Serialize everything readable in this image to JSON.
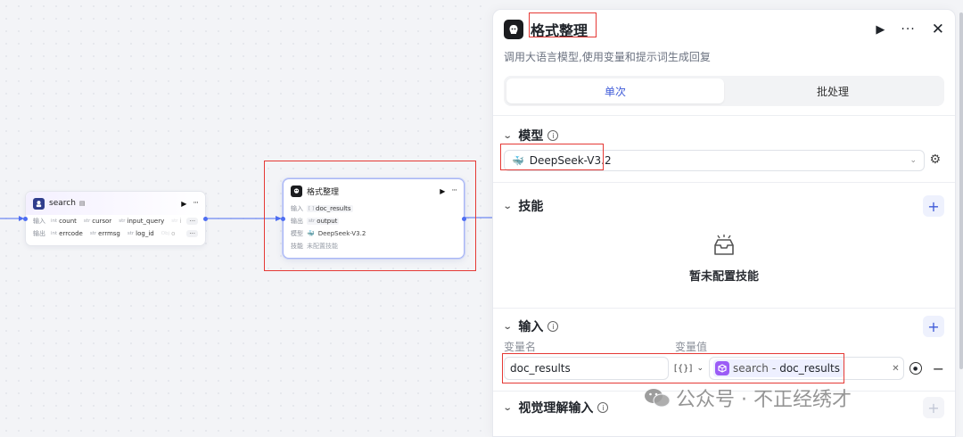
{
  "canvas": {
    "search_node": {
      "title": "search",
      "input_label": "输入",
      "output_label": "输出",
      "inputs": [
        {
          "type": "int",
          "name": "count"
        },
        {
          "type": "str",
          "name": "cursor"
        },
        {
          "type": "str",
          "name": "input_query"
        },
        {
          "type": "str",
          "name": "i"
        }
      ],
      "outputs": [
        {
          "type": "int",
          "name": "errcode"
        },
        {
          "type": "str",
          "name": "errmsg"
        },
        {
          "type": "str",
          "name": "log_id"
        },
        {
          "type": "Obj",
          "name": "o"
        }
      ],
      "more": "···"
    },
    "format_node": {
      "title": "格式整理",
      "rows": [
        {
          "label": "输入",
          "type": "[ ]",
          "value": "doc_results"
        },
        {
          "label": "输出",
          "type": "str",
          "value": "output"
        },
        {
          "label": "模型",
          "type": "",
          "value": "DeepSeek-V3.2"
        },
        {
          "label": "技能",
          "type": "",
          "value": "未配置技能"
        }
      ],
      "more": "···"
    }
  },
  "panel": {
    "title": "格式整理",
    "description": "调用大语言模型,使用变量和提示词生成回复",
    "tabs": [
      "单次",
      "批处理"
    ],
    "active_tab": 0,
    "model_section": {
      "title": "模型",
      "selected_model": "DeepSeek-V3.2"
    },
    "skills_section": {
      "title": "技能",
      "empty_text": "暂未配置技能"
    },
    "input_section": {
      "title": "输入",
      "col_name": "变量名",
      "col_value": "变量值",
      "rows": [
        {
          "name": "doc_results",
          "type": "[{}]",
          "ref_node": "search",
          "ref_sep": "-",
          "ref_field": "doc_results"
        }
      ]
    },
    "vision_section": {
      "title": "视觉理解输入"
    }
  },
  "watermark": "公众号 · 不正经绣才",
  "colors": {
    "accent": "#3f5bd8",
    "edge": "#4e6ef2",
    "highlight": "#e53935"
  }
}
